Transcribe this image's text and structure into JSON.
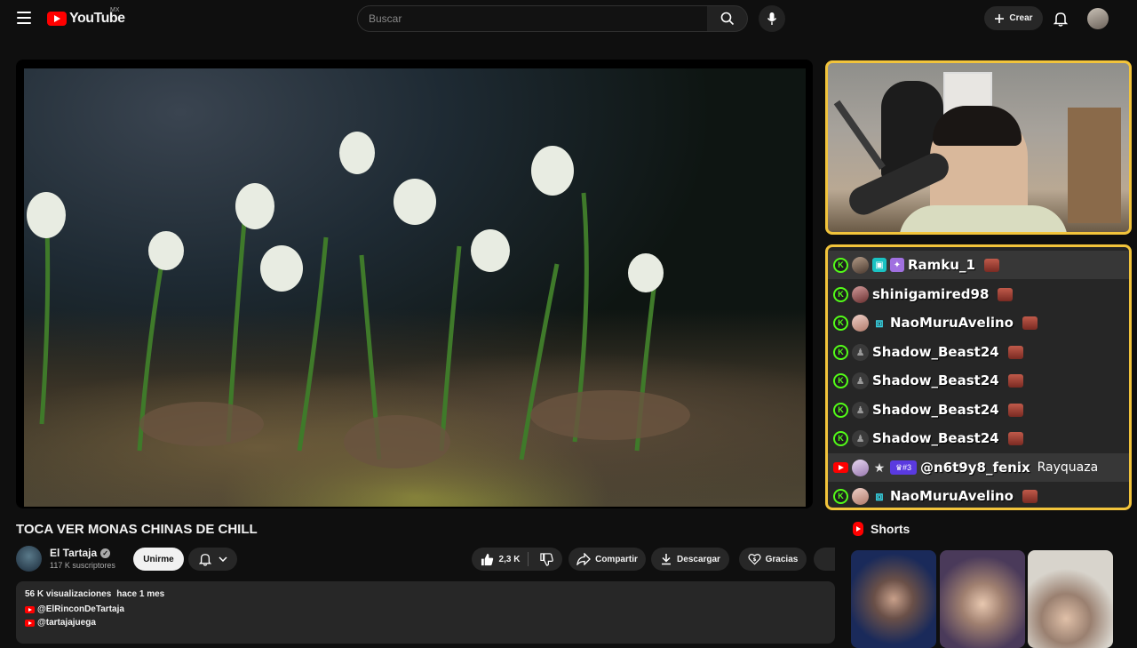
{
  "header": {
    "logo_text": "YouTube",
    "country_code": "MX",
    "search_placeholder": "Buscar",
    "create_label": "Crear"
  },
  "video": {
    "title": "TOCA VER MONAS CHINAS DE CHILL",
    "channel_name": "El Tartaja",
    "subscribers": "117 K suscriptores",
    "join_label": "Unirme",
    "likes": "2,3 K",
    "share_label": "Compartir",
    "download_label": "Descargar",
    "thanks_label": "Gracias"
  },
  "description": {
    "views": "56 K visualizaciones",
    "age": "hace 1 mes",
    "links": [
      "@ElRinconDeTartaja",
      "@tartajajuega"
    ]
  },
  "chat": {
    "messages": [
      {
        "platform": "kick",
        "user": "Ramku_1",
        "message": ""
      },
      {
        "platform": "kick",
        "user": "shinigamired98",
        "message": ""
      },
      {
        "platform": "kick",
        "user": "NaoMuruAvelino",
        "message": ""
      },
      {
        "platform": "kick",
        "user": "Shadow_Beast24",
        "message": ""
      },
      {
        "platform": "kick",
        "user": "Shadow_Beast24",
        "message": ""
      },
      {
        "platform": "kick",
        "user": "Shadow_Beast24",
        "message": ""
      },
      {
        "platform": "kick",
        "user": "Shadow_Beast24",
        "message": ""
      },
      {
        "platform": "youtube",
        "user": "@n6t9y8_fenix",
        "message": "Rayquaza"
      },
      {
        "platform": "kick",
        "user": "NaoMuruAvelino",
        "message": ""
      }
    ],
    "kick_badge": "K",
    "crown_badge_text": "#3"
  },
  "shorts": {
    "label": "Shorts"
  },
  "colors": {
    "accent_red": "#ff0000",
    "overlay_border": "#f2c43b",
    "kick_green": "#53fc18"
  }
}
